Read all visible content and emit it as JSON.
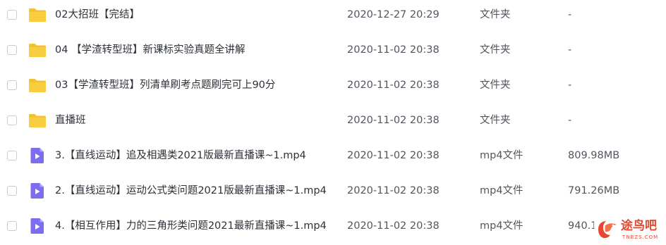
{
  "files": [
    {
      "name": "02大招班【完结】",
      "modified": "2020-12-27 20:29",
      "type": "文件夹",
      "size": "-",
      "icon": "folder-icon"
    },
    {
      "name": "04 【学渣转型班】新课标实验真题全讲解",
      "modified": "2020-11-02 20:38",
      "type": "文件夹",
      "size": "-",
      "icon": "folder-icon"
    },
    {
      "name": "03【学渣转型班】列清单刷考点题刷完可上90分",
      "modified": "2020-11-02 20:38",
      "type": "文件夹",
      "size": "-",
      "icon": "folder-icon"
    },
    {
      "name": "直播班",
      "modified": "2020-11-02 20:38",
      "type": "文件夹",
      "size": "-",
      "icon": "folder-icon"
    },
    {
      "name": "3.【直线运动】追及相遇类2021版最新直播课~1.mp4",
      "modified": "2020-11-02 20:38",
      "type": "mp4文件",
      "size": "809.98MB",
      "icon": "video-file-icon"
    },
    {
      "name": "2.【直线运动】运动公式类问题2021版最新直播课~1.mp4",
      "modified": "2020-11-02 20:38",
      "type": "mp4文件",
      "size": "791.26MB",
      "icon": "video-file-icon"
    },
    {
      "name": "4.【相互作用】力的三角形类问题2021最新直播课~1.mp4",
      "modified": "2020-11-02 20:38",
      "type": "mp4文件",
      "size": "940.1",
      "icon": "video-file-icon"
    }
  ],
  "watermark": {
    "text": "途鸟吧",
    "sub": "TNBZS.COM"
  },
  "colors": {
    "folder": "#f5c12e",
    "video": "#7c6cf2",
    "watermark": "#e8472f"
  }
}
